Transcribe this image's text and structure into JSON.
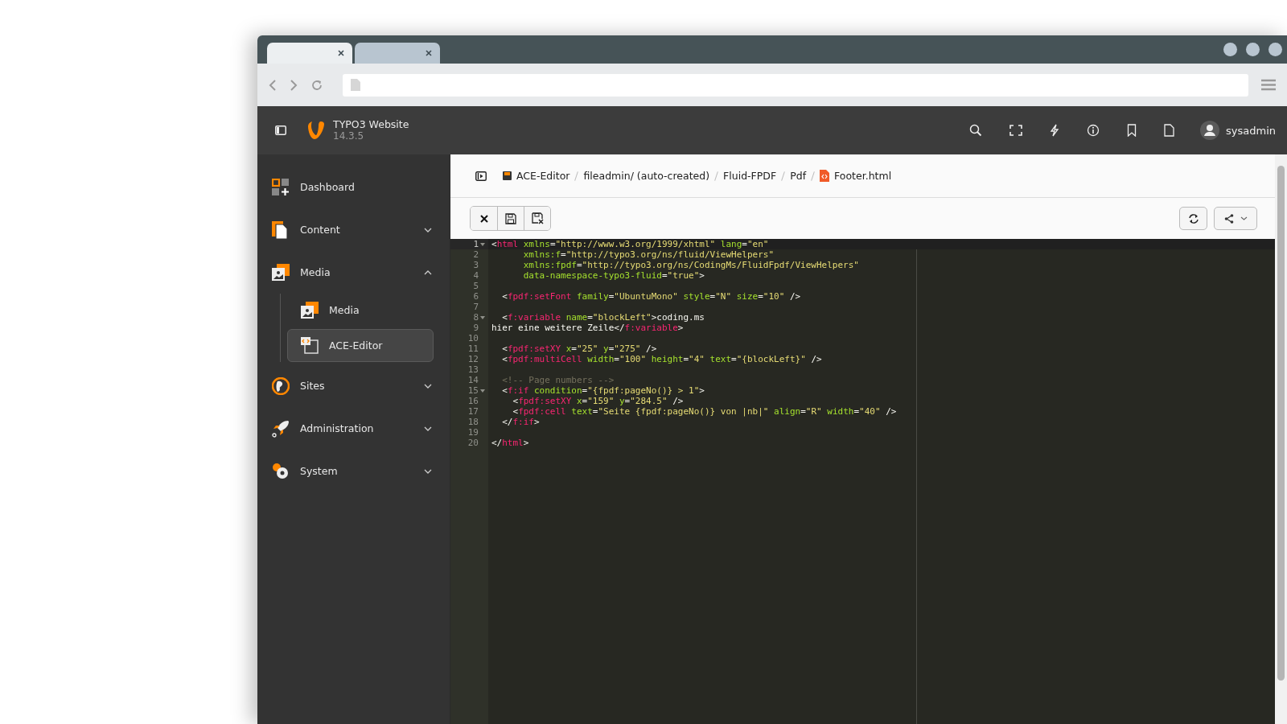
{
  "browser": {
    "tabs": [
      {
        "selected": true
      },
      {
        "selected": false
      }
    ]
  },
  "header": {
    "title": "TYPO3 Website",
    "version": "14.3.5",
    "user": "sysadmin"
  },
  "sidebar": {
    "items": [
      {
        "label": "Dashboard"
      },
      {
        "label": "Content",
        "expanded": false
      },
      {
        "label": "Media",
        "expanded": true,
        "children": [
          {
            "label": "Media",
            "selected": false
          },
          {
            "label": "ACE-Editor",
            "selected": true
          }
        ]
      },
      {
        "label": "Sites",
        "expanded": false
      },
      {
        "label": "Administration",
        "expanded": false
      },
      {
        "label": "System",
        "expanded": false
      }
    ]
  },
  "breadcrumb": [
    "ACE-Editor",
    "fileadmin/ (auto-created)",
    "Fluid-FPDF",
    "Pdf",
    "Footer.html"
  ],
  "editor": {
    "lines": [
      {
        "number": "1",
        "fold": true,
        "active": true,
        "tokens": [
          {
            "kind": "punct",
            "text": "<"
          },
          {
            "kind": "tag",
            "text": "html"
          },
          {
            "kind": "attr",
            "text": " xmlns"
          },
          {
            "kind": "punct",
            "text": "="
          },
          {
            "kind": "string",
            "text": "\"http://www.w3.org/1999/xhtml\""
          },
          {
            "kind": "attr",
            "text": " lang"
          },
          {
            "kind": "punct",
            "text": "="
          },
          {
            "kind": "string",
            "text": "\"en\""
          }
        ]
      },
      {
        "number": "2",
        "fold": false,
        "active": false,
        "tokens": [
          {
            "kind": "attr",
            "text": "      xmlns:f"
          },
          {
            "kind": "punct",
            "text": "="
          },
          {
            "kind": "string",
            "text": "\"http://typo3.org/ns/fluid/ViewHelpers\""
          }
        ]
      },
      {
        "number": "3",
        "fold": false,
        "active": false,
        "tokens": [
          {
            "kind": "attr",
            "text": "      xmlns:fpdf"
          },
          {
            "kind": "punct",
            "text": "="
          },
          {
            "kind": "string",
            "text": "\"http://typo3.org/ns/CodingMs/FluidFpdf/ViewHelpers\""
          }
        ]
      },
      {
        "number": "4",
        "fold": false,
        "active": false,
        "tokens": [
          {
            "kind": "attr",
            "text": "      data-namespace-typo3-fluid"
          },
          {
            "kind": "punct",
            "text": "="
          },
          {
            "kind": "string",
            "text": "\"true\""
          },
          {
            "kind": "punct",
            "text": ">"
          }
        ]
      },
      {
        "number": "5",
        "fold": false,
        "active": false
      },
      {
        "number": "6",
        "fold": false,
        "active": false,
        "tokens": [
          {
            "kind": "punct",
            "text": "  <"
          },
          {
            "kind": "tag",
            "text": "fpdf:setFont"
          },
          {
            "kind": "attr",
            "text": " family"
          },
          {
            "kind": "punct",
            "text": "="
          },
          {
            "kind": "string",
            "text": "\"UbuntuMono\""
          },
          {
            "kind": "attr",
            "text": " style"
          },
          {
            "kind": "punct",
            "text": "="
          },
          {
            "kind": "string",
            "text": "\"N\""
          },
          {
            "kind": "attr",
            "text": " size"
          },
          {
            "kind": "punct",
            "text": "="
          },
          {
            "kind": "string",
            "text": "\"10\""
          },
          {
            "kind": "punct",
            "text": " />"
          }
        ]
      },
      {
        "number": "7",
        "fold": false,
        "active": false
      },
      {
        "number": "8",
        "fold": true,
        "active": false,
        "tokens": [
          {
            "kind": "punct",
            "text": "  <"
          },
          {
            "kind": "tag",
            "text": "f:variable"
          },
          {
            "kind": "attr",
            "text": " name"
          },
          {
            "kind": "punct",
            "text": "="
          },
          {
            "kind": "string",
            "text": "\"blockLeft\""
          },
          {
            "kind": "punct",
            "text": ">coding.ms"
          }
        ]
      },
      {
        "number": "9",
        "fold": false,
        "active": false,
        "tokens": [
          {
            "kind": "punct",
            "text": "hier eine weitere Zeile</"
          },
          {
            "kind": "tag",
            "text": "f:variable"
          },
          {
            "kind": "punct",
            "text": ">"
          }
        ]
      },
      {
        "number": "10",
        "fold": false,
        "active": false
      },
      {
        "number": "11",
        "fold": false,
        "active": false,
        "tokens": [
          {
            "kind": "punct",
            "text": "  <"
          },
          {
            "kind": "tag",
            "text": "fpdf:setXY"
          },
          {
            "kind": "attr",
            "text": " x"
          },
          {
            "kind": "punct",
            "text": "="
          },
          {
            "kind": "string",
            "text": "\"25\""
          },
          {
            "kind": "attr",
            "text": " y"
          },
          {
            "kind": "punct",
            "text": "="
          },
          {
            "kind": "string",
            "text": "\"275\""
          },
          {
            "kind": "punct",
            "text": " />"
          }
        ]
      },
      {
        "number": "12",
        "fold": false,
        "active": false,
        "tokens": [
          {
            "kind": "punct",
            "text": "  <"
          },
          {
            "kind": "tag",
            "text": "fpdf:multiCell"
          },
          {
            "kind": "attr",
            "text": " width"
          },
          {
            "kind": "punct",
            "text": "="
          },
          {
            "kind": "string",
            "text": "\"100\""
          },
          {
            "kind": "attr",
            "text": " height"
          },
          {
            "kind": "punct",
            "text": "="
          },
          {
            "kind": "string",
            "text": "\"4\""
          },
          {
            "kind": "attr",
            "text": " text"
          },
          {
            "kind": "punct",
            "text": "="
          },
          {
            "kind": "string",
            "text": "\"{blockLeft}\""
          },
          {
            "kind": "punct",
            "text": " />"
          }
        ]
      },
      {
        "number": "13",
        "fold": false,
        "active": false
      },
      {
        "number": "14",
        "fold": false,
        "active": false,
        "tokens": [
          {
            "kind": "comment",
            "text": "  <!-- Page numbers -->"
          }
        ]
      },
      {
        "number": "15",
        "fold": true,
        "active": false,
        "tokens": [
          {
            "kind": "punct",
            "text": "  <"
          },
          {
            "kind": "tag",
            "text": "f:if"
          },
          {
            "kind": "attr",
            "text": " condition"
          },
          {
            "kind": "punct",
            "text": "="
          },
          {
            "kind": "string",
            "text": "\"{fpdf:pageNo()} > 1\""
          },
          {
            "kind": "punct",
            "text": ">"
          }
        ]
      },
      {
        "number": "16",
        "fold": false,
        "active": false,
        "tokens": [
          {
            "kind": "punct",
            "text": "    <"
          },
          {
            "kind": "tag",
            "text": "fpdf:setXY"
          },
          {
            "kind": "attr",
            "text": " x"
          },
          {
            "kind": "punct",
            "text": "="
          },
          {
            "kind": "string",
            "text": "\"159\""
          },
          {
            "kind": "attr",
            "text": " y"
          },
          {
            "kind": "punct",
            "text": "="
          },
          {
            "kind": "string",
            "text": "\"284.5\""
          },
          {
            "kind": "punct",
            "text": " />"
          }
        ]
      },
      {
        "number": "17",
        "fold": false,
        "active": false,
        "tokens": [
          {
            "kind": "punct",
            "text": "    <"
          },
          {
            "kind": "tag",
            "text": "fpdf:cell"
          },
          {
            "kind": "attr",
            "text": " text"
          },
          {
            "kind": "punct",
            "text": "="
          },
          {
            "kind": "string",
            "text": "\"Seite {fpdf:pageNo()} von |nb|\""
          },
          {
            "kind": "attr",
            "text": " align"
          },
          {
            "kind": "punct",
            "text": "="
          },
          {
            "kind": "string",
            "text": "\"R\""
          },
          {
            "kind": "attr",
            "text": " width"
          },
          {
            "kind": "punct",
            "text": "="
          },
          {
            "kind": "string",
            "text": "\"40\""
          },
          {
            "kind": "punct",
            "text": " />"
          }
        ]
      },
      {
        "number": "18",
        "fold": false,
        "active": false,
        "tokens": [
          {
            "kind": "punct",
            "text": "  </"
          },
          {
            "kind": "tag",
            "text": "f:if"
          },
          {
            "kind": "punct",
            "text": ">"
          }
        ]
      },
      {
        "number": "19",
        "fold": false,
        "active": false
      },
      {
        "number": "20",
        "fold": false,
        "active": false,
        "tokens": [
          {
            "kind": "punct",
            "text": "</"
          },
          {
            "kind": "tag",
            "text": "html"
          },
          {
            "kind": "punct",
            "text": ">"
          }
        ]
      }
    ]
  }
}
